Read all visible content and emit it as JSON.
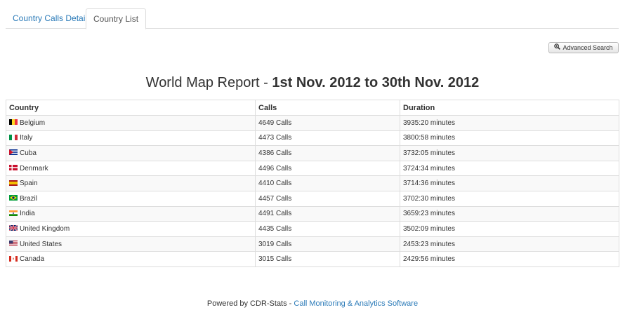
{
  "tabs": [
    {
      "label": "Country Calls Detail",
      "active": false
    },
    {
      "label": "Country List",
      "active": true
    }
  ],
  "advanced_search": {
    "label": "Advanced Search",
    "icon": "zoom-in-icon"
  },
  "report": {
    "title_prefix": "World Map Report - ",
    "title_range": "1st Nov. 2012 to 30th Nov. 2012"
  },
  "table": {
    "headers": {
      "country": "Country",
      "calls": "Calls",
      "duration": "Duration"
    },
    "rows": [
      {
        "flag": "belgium-flag-icon",
        "country": "Belgium",
        "calls": "4649 Calls",
        "duration": "3935:20 minutes"
      },
      {
        "flag": "italy-flag-icon",
        "country": "Italy",
        "calls": "4473 Calls",
        "duration": "3800:58 minutes"
      },
      {
        "flag": "cuba-flag-icon",
        "country": "Cuba",
        "calls": "4386 Calls",
        "duration": "3732:05 minutes"
      },
      {
        "flag": "denmark-flag-icon",
        "country": "Denmark",
        "calls": "4496 Calls",
        "duration": "3724:34 minutes"
      },
      {
        "flag": "spain-flag-icon",
        "country": "Spain",
        "calls": "4410 Calls",
        "duration": "3714:36 minutes"
      },
      {
        "flag": "brazil-flag-icon",
        "country": "Brazil",
        "calls": "4457 Calls",
        "duration": "3702:30 minutes"
      },
      {
        "flag": "india-flag-icon",
        "country": "India",
        "calls": "4491 Calls",
        "duration": "3659:23 minutes"
      },
      {
        "flag": "uk-flag-icon",
        "country": "United Kingdom",
        "calls": "4435 Calls",
        "duration": "3502:09 minutes"
      },
      {
        "flag": "us-flag-icon",
        "country": "United States",
        "calls": "3019 Calls",
        "duration": "2453:23 minutes"
      },
      {
        "flag": "canada-flag-icon",
        "country": "Canada",
        "calls": "3015 Calls",
        "duration": "2429:56 minutes"
      }
    ]
  },
  "footer": {
    "prefix": "Powered by CDR-Stats - ",
    "link": "Call Monitoring & Analytics Software"
  },
  "colors": {
    "link": "#2a7ab8",
    "border": "#dddddd",
    "stripe": "#f9f9f9"
  }
}
